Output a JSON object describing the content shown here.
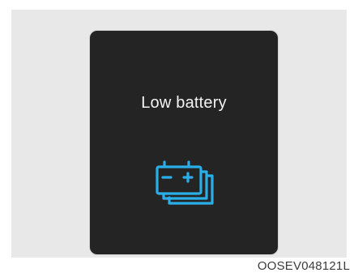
{
  "warning": {
    "message": "Low battery",
    "icon": "stacked-battery-icon",
    "icon_color": "#2aaee8",
    "panel_color": "#252424",
    "text_color": "#f4f4f4"
  },
  "figure": {
    "code": "OOSEV048121L"
  }
}
